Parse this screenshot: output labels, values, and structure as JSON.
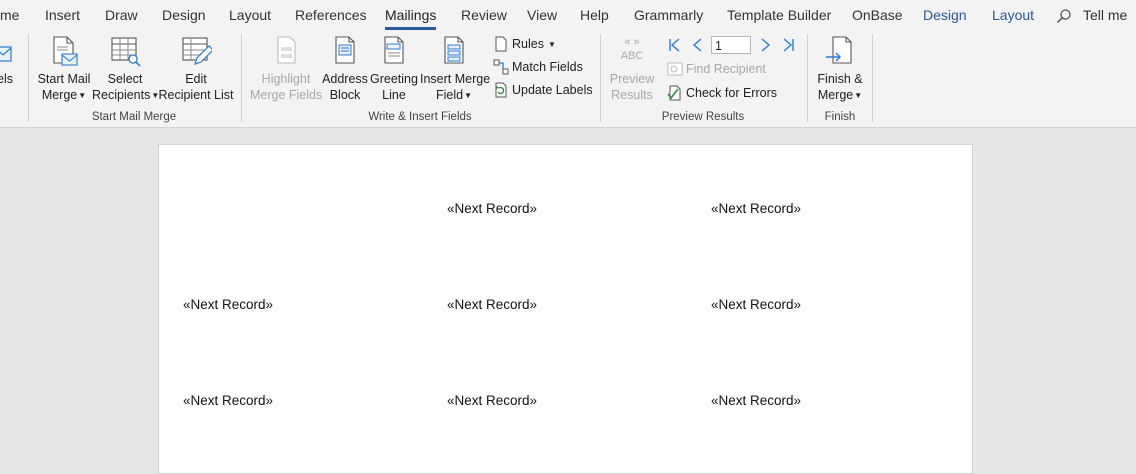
{
  "tabs": [
    {
      "label": "me",
      "active": false,
      "blue": false
    },
    {
      "label": "Insert",
      "active": false,
      "blue": false
    },
    {
      "label": "Draw",
      "active": false,
      "blue": false
    },
    {
      "label": "Design",
      "active": false,
      "blue": false
    },
    {
      "label": "Layout",
      "active": false,
      "blue": false
    },
    {
      "label": "References",
      "active": false,
      "blue": false
    },
    {
      "label": "Mailings",
      "active": true,
      "blue": false
    },
    {
      "label": "Review",
      "active": false,
      "blue": false
    },
    {
      "label": "View",
      "active": false,
      "blue": false
    },
    {
      "label": "Help",
      "active": false,
      "blue": false
    },
    {
      "label": "Grammarly",
      "active": false,
      "blue": false
    },
    {
      "label": "Template Builder",
      "active": false,
      "blue": false
    },
    {
      "label": "OnBase",
      "active": false,
      "blue": false
    },
    {
      "label": "Design",
      "active": false,
      "blue": true
    },
    {
      "label": "Layout",
      "active": false,
      "blue": true
    }
  ],
  "tell_me": "Tell me",
  "ribbon": {
    "partial_button": {
      "label": "els"
    },
    "start_mail_merge": {
      "group_label": "Start Mail Merge",
      "start_mail_merge": {
        "line1": "Start Mail",
        "line2": "Merge"
      },
      "select_recipients": {
        "line1": "Select",
        "line2": "Recipients"
      },
      "edit_recipient_list": {
        "line1": "Edit",
        "line2": "Recipient List"
      }
    },
    "write_insert": {
      "group_label": "Write & Insert Fields",
      "highlight": {
        "line1": "Highlight",
        "line2": "Merge Fields"
      },
      "address_block": {
        "line1": "Address",
        "line2": "Block"
      },
      "greeting_line": {
        "line1": "Greeting",
        "line2": "Line"
      },
      "insert_merge_field": {
        "line1": "Insert Merge",
        "line2": "Field"
      },
      "rules": "Rules",
      "match_fields": "Match Fields",
      "update_labels": "Update Labels"
    },
    "preview": {
      "group_label": "Preview Results",
      "abc_glyph": "ABC",
      "preview_results": {
        "line1": "Preview",
        "line2": "Results"
      },
      "record_number": "1",
      "find_recipient": "Find Recipient",
      "check_for_errors": "Check for Errors"
    },
    "finish": {
      "group_label": "Finish",
      "finish_merge": {
        "line1": "Finish &",
        "line2": "Merge"
      }
    }
  },
  "document": {
    "records": [
      "«Next Record»",
      "«Next Record»",
      "«Next Record»",
      "«Next Record»",
      "«Next Record»",
      "«Next Record»",
      "«Next Record»",
      "«Next Record»"
    ]
  },
  "colors": {
    "accent": "#2b579a",
    "tab_bar": "#f3f3f3",
    "workspace": "#e6e6e6",
    "disabled_text": "#a8a8a8"
  }
}
